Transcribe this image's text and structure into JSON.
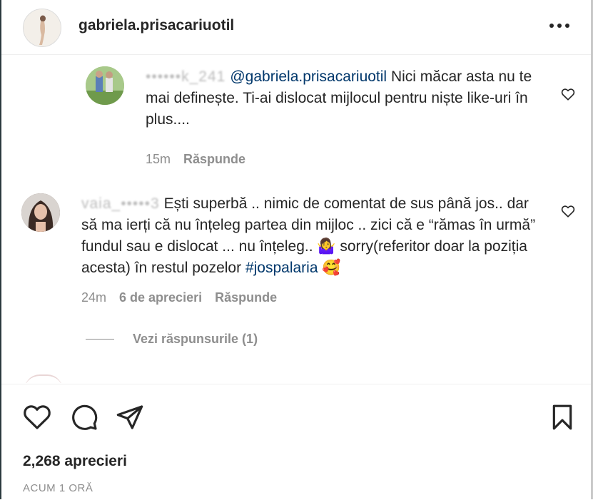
{
  "header": {
    "username": "gabriela.prisacariuotil",
    "more_icon": "more-options-icon"
  },
  "reply_comment": {
    "username_obscured": "••••••k_241",
    "mention": "@gabriela.prisacariuotil",
    "text": " Nici măcar asta nu te mai definește. Ti-ai dislocat mijlocul pentru niște like-uri în plus....",
    "time": "15m",
    "reply_label": "Răspunde"
  },
  "comment": {
    "username_obscured": "vaia_•••••3",
    "text_before_hashtag": "Ești superbă .. nimic de comentat de sus până jos.. dar să ma ierți că nu înțeleg partea din mijloc .. zici că e “rămas în urmă” fundul sau e dislocat ... nu înțeleg.. 🤷‍♀️ sorry(referitor doar la poziția acesta) în restul pozelor ",
    "hashtag": "#jospalaria",
    "emoji_end": " 🥰",
    "time": "24m",
    "likes": "6 de aprecieri",
    "reply_label": "Răspunde"
  },
  "view_replies": "Vezi răspunsurile (1)",
  "footer": {
    "likes_count": "2,268 aprecieri",
    "posted": "ACUM 1 ORĂ"
  },
  "icons": [
    "heart-icon",
    "comment-icon",
    "share-icon",
    "bookmark-icon"
  ]
}
